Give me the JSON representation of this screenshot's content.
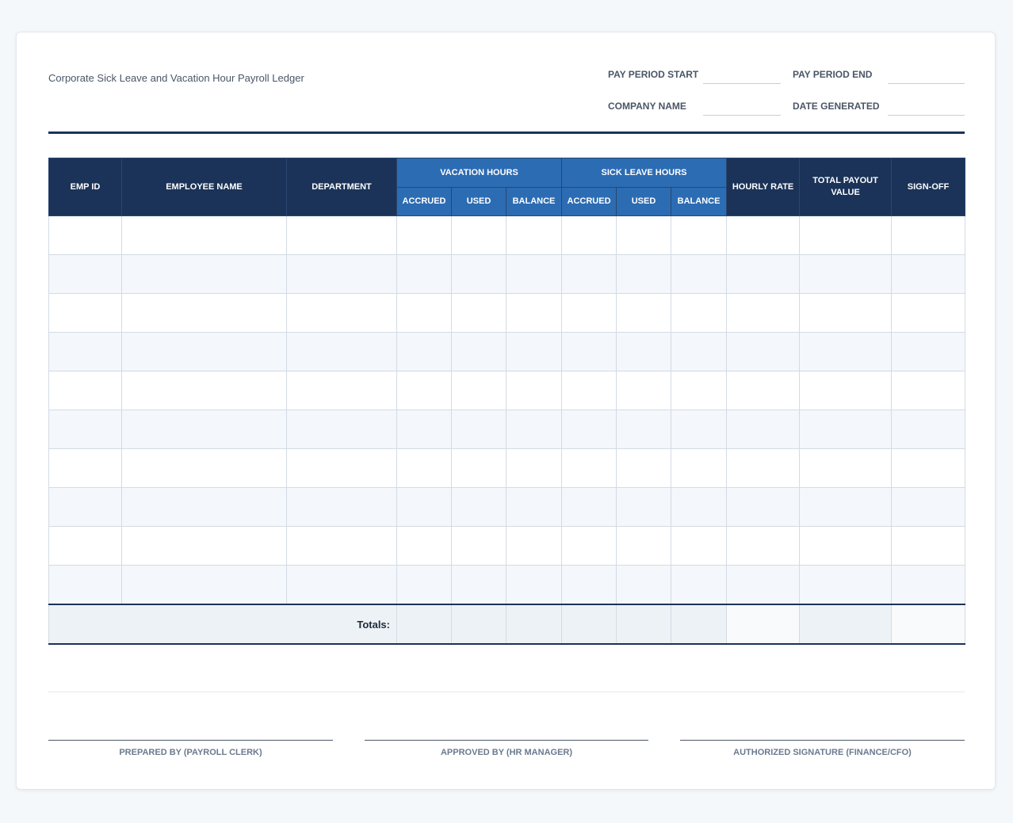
{
  "document": {
    "title": "Corporate Sick Leave and Vacation Hour Payroll Ledger"
  },
  "meta": {
    "pay_period_start": {
      "label": "PAY PERIOD START",
      "value": ""
    },
    "pay_period_end": {
      "label": "PAY PERIOD END",
      "value": ""
    },
    "company_name": {
      "label": "COMPANY NAME",
      "value": ""
    },
    "date_generated": {
      "label": "DATE GENERATED",
      "value": ""
    }
  },
  "table": {
    "headers": {
      "emp_id": "EMP ID",
      "employee_name": "EMPLOYEE NAME",
      "department": "DEPARTMENT",
      "vacation_hours": "VACATION HOURS",
      "sick_leave_hours": "SICK LEAVE HOURS",
      "accrued": "ACCRUED",
      "used": "USED",
      "balance": "BALANCE",
      "hourly_rate": "HOURLY RATE",
      "total_payout_value": "TOTAL PAYOUT VALUE",
      "sign_off": "SIGN-OFF"
    },
    "rows": [
      [
        "",
        "",
        "",
        "",
        "",
        "",
        "",
        "",
        "",
        "",
        "",
        ""
      ],
      [
        "",
        "",
        "",
        "",
        "",
        "",
        "",
        "",
        "",
        "",
        "",
        ""
      ],
      [
        "",
        "",
        "",
        "",
        "",
        "",
        "",
        "",
        "",
        "",
        "",
        ""
      ],
      [
        "",
        "",
        "",
        "",
        "",
        "",
        "",
        "",
        "",
        "",
        "",
        ""
      ],
      [
        "",
        "",
        "",
        "",
        "",
        "",
        "",
        "",
        "",
        "",
        "",
        ""
      ],
      [
        "",
        "",
        "",
        "",
        "",
        "",
        "",
        "",
        "",
        "",
        "",
        ""
      ],
      [
        "",
        "",
        "",
        "",
        "",
        "",
        "",
        "",
        "",
        "",
        "",
        ""
      ],
      [
        "",
        "",
        "",
        "",
        "",
        "",
        "",
        "",
        "",
        "",
        "",
        ""
      ],
      [
        "",
        "",
        "",
        "",
        "",
        "",
        "",
        "",
        "",
        "",
        "",
        ""
      ],
      [
        "",
        "",
        "",
        "",
        "",
        "",
        "",
        "",
        "",
        "",
        "",
        ""
      ]
    ],
    "totals_label": "Totals:"
  },
  "signatures": {
    "prepared_by": "PREPARED BY (PAYROLL CLERK)",
    "approved_by": "APPROVED BY (HR MANAGER)",
    "authorized": "AUTHORIZED SIGNATURE (FINANCE/CFO)"
  },
  "colors": {
    "header_dark": "#1b3358",
    "header_light": "#2c6cb3",
    "row_alt": "#f4f7fb"
  }
}
